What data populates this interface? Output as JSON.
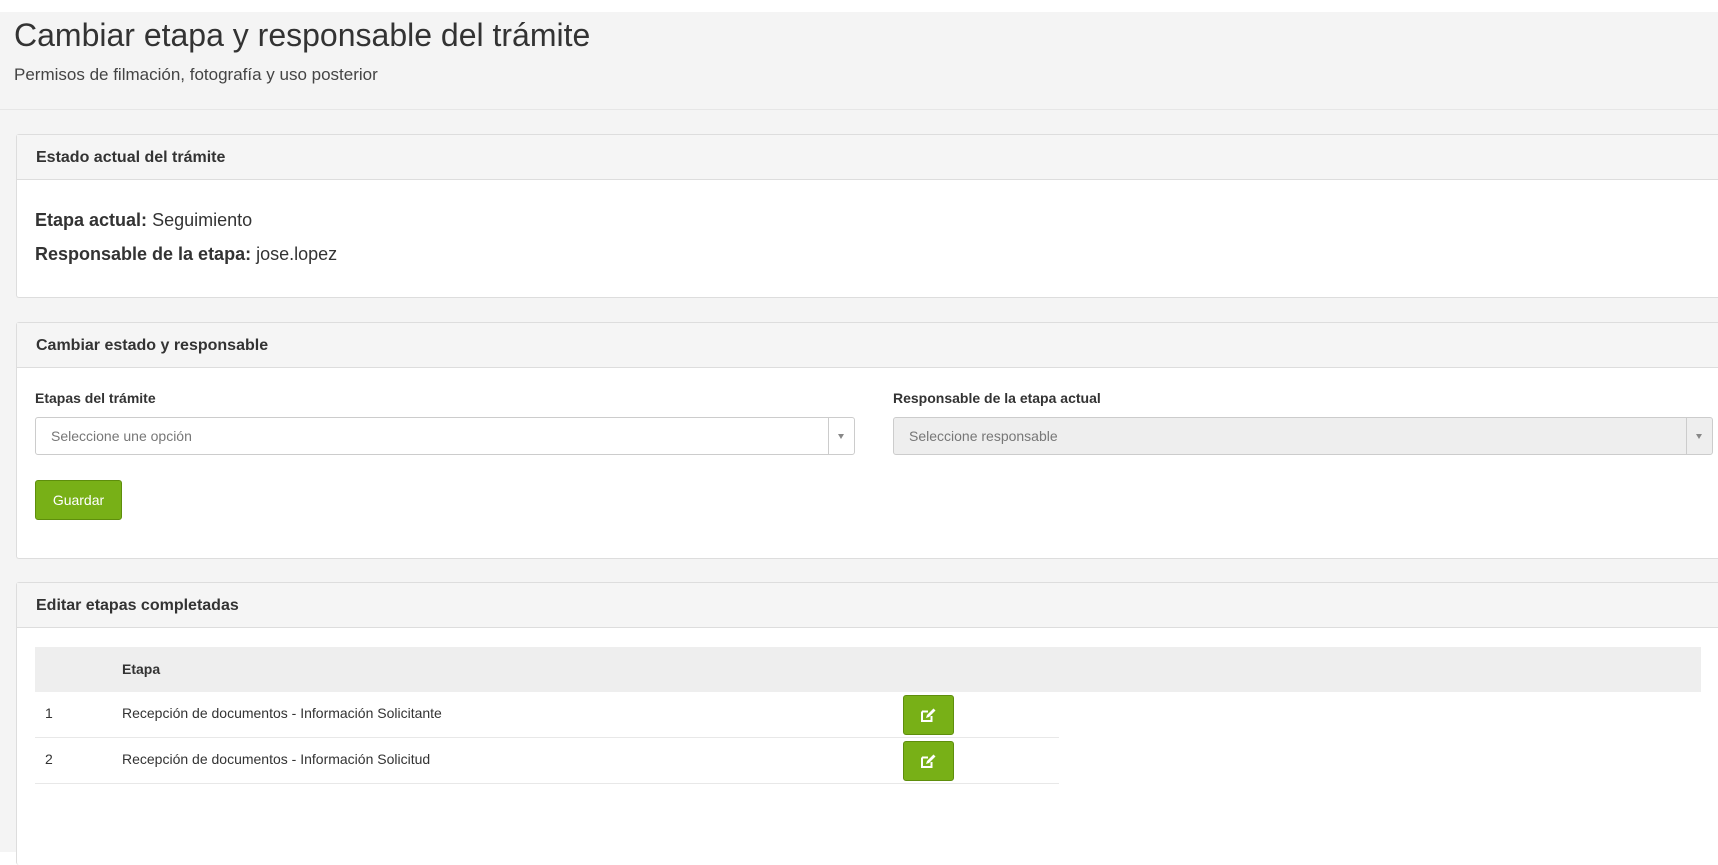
{
  "header": {
    "title": "Cambiar etapa y responsable del trámite",
    "subtitle": "Permisos de filmación, fotografía y uso posterior"
  },
  "estado_panel": {
    "heading": "Estado actual del trámite",
    "etapa_label": "Etapa actual:",
    "etapa_value": "Seguimiento",
    "responsable_label": "Responsable de la etapa:",
    "responsable_value": "jose.lopez"
  },
  "cambiar_panel": {
    "heading": "Cambiar estado y responsable",
    "etapas_label": "Etapas del trámite",
    "etapas_placeholder": "Seleccione une opción",
    "responsable_label": "Responsable de la etapa actual",
    "responsable_placeholder": "Seleccione responsable",
    "save_label": "Guardar"
  },
  "editar_panel": {
    "heading": "Editar etapas completadas",
    "column_etapa": "Etapa",
    "rows": [
      {
        "num": "1",
        "name": "Recepción de documentos - Información Solicitante"
      },
      {
        "num": "2",
        "name": "Recepción de documentos - Información Solicitud"
      }
    ]
  },
  "colors": {
    "accent": "#78b017",
    "accent_border": "#5e8e0c"
  },
  "icons": {
    "edit": "edit-icon",
    "dropdown": "chevron-down-icon"
  }
}
